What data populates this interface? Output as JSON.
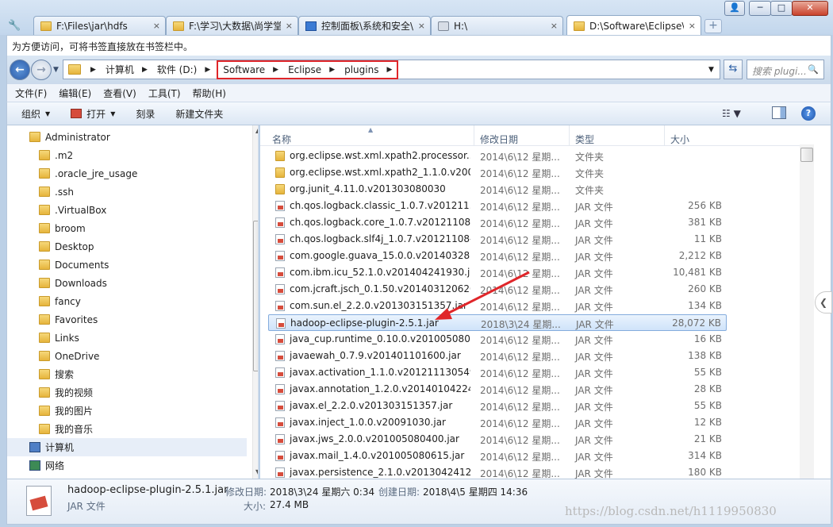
{
  "tabs": [
    {
      "title": "F:\\Files\\jar\\hdfs",
      "icon": "folder-icon",
      "active": false
    },
    {
      "title": "F:\\学习\\大数据\\尚学堂",
      "icon": "folder-icon",
      "active": false
    },
    {
      "title": "控制面板\\系统和安全\\",
      "icon": "control-panel-icon",
      "active": false
    },
    {
      "title": "H:\\",
      "icon": "drive-icon",
      "active": false
    },
    {
      "title": "D:\\Software\\Eclipse\\",
      "icon": "folder-icon",
      "active": true
    }
  ],
  "tab_close": "×",
  "new_tab": "+",
  "window_buttons": {
    "user": "👤",
    "minimize": "─",
    "maximize": "□",
    "close": "✕"
  },
  "bookmark_hint": "为方便访问，可将书签直接放在书签栏中。",
  "address": {
    "crumbs_plain": [
      "计算机",
      "软件 (D:)"
    ],
    "crumbs_highlighted": [
      "Software",
      "Eclipse",
      "plugins"
    ],
    "search_placeholder": "搜索 plugi...",
    "search_icon": "🔍",
    "refresh_icon": "⇆"
  },
  "menu": [
    "文件(F)",
    "编辑(E)",
    "查看(V)",
    "工具(T)",
    "帮助(H)"
  ],
  "toolbar": {
    "organize": "组织",
    "open": "打开",
    "burn": "刻录",
    "new_folder": "新建文件夹",
    "help": "?"
  },
  "nav": {
    "items": [
      {
        "label": "Administrator",
        "icon": "user-folder-icon"
      },
      {
        "label": ".m2",
        "icon": "folder-icon"
      },
      {
        "label": ".oracle_jre_usage",
        "icon": "folder-icon"
      },
      {
        "label": ".ssh",
        "icon": "folder-icon"
      },
      {
        "label": ".VirtualBox",
        "icon": "folder-icon"
      },
      {
        "label": "broom",
        "icon": "folder-icon"
      },
      {
        "label": "Desktop",
        "icon": "desktop-folder-icon"
      },
      {
        "label": "Documents",
        "icon": "documents-folder-icon"
      },
      {
        "label": "Downloads",
        "icon": "downloads-folder-icon"
      },
      {
        "label": "fancy",
        "icon": "folder-icon"
      },
      {
        "label": "Favorites",
        "icon": "favorites-folder-icon"
      },
      {
        "label": "Links",
        "icon": "links-folder-icon"
      },
      {
        "label": "OneDrive",
        "icon": "onedrive-folder-icon"
      },
      {
        "label": "搜索",
        "icon": "search-folder-icon"
      },
      {
        "label": "我的视频",
        "icon": "videos-folder-icon"
      },
      {
        "label": "我的图片",
        "icon": "pictures-folder-icon"
      },
      {
        "label": "我的音乐",
        "icon": "music-folder-icon"
      },
      {
        "label": "计算机",
        "icon": "computer-icon"
      },
      {
        "label": "网络",
        "icon": "network-icon"
      }
    ]
  },
  "columns": {
    "name": "名称",
    "date": "修改日期",
    "type": "类型",
    "size": "大小"
  },
  "files": [
    {
      "name": "org.eclipse.wst.xml.xpath2.processor....",
      "date": "2014\\6\\12 星期...",
      "type": "文件夹",
      "size": "",
      "kind": "folder"
    },
    {
      "name": "org.eclipse.wst.xml.xpath2_1.1.0.v200...",
      "date": "2014\\6\\12 星期...",
      "type": "文件夹",
      "size": "",
      "kind": "folder"
    },
    {
      "name": "org.junit_4.11.0.v201303080030",
      "date": "2014\\6\\12 星期...",
      "type": "文件夹",
      "size": "",
      "kind": "folder"
    },
    {
      "name": "ch.qos.logback.classic_1.0.7.v201211...",
      "date": "2014\\6\\12 星期...",
      "type": "JAR 文件",
      "size": "256 KB",
      "kind": "jar"
    },
    {
      "name": "ch.qos.logback.core_1.0.7.v20121108...",
      "date": "2014\\6\\12 星期...",
      "type": "JAR 文件",
      "size": "381 KB",
      "kind": "jar"
    },
    {
      "name": "ch.qos.logback.slf4j_1.0.7.v20121108-...",
      "date": "2014\\6\\12 星期...",
      "type": "JAR 文件",
      "size": "11 KB",
      "kind": "jar"
    },
    {
      "name": "com.google.guava_15.0.0.v20140328...",
      "date": "2014\\6\\12 星期...",
      "type": "JAR 文件",
      "size": "2,212 KB",
      "kind": "jar"
    },
    {
      "name": "com.ibm.icu_52.1.0.v201404241930.jar",
      "date": "2014\\6\\12 星期...",
      "type": "JAR 文件",
      "size": "10,481 KB",
      "kind": "jar"
    },
    {
      "name": "com.jcraft.jsch_0.1.50.v201403120620....",
      "date": "2014\\6\\12 星期...",
      "type": "JAR 文件",
      "size": "260 KB",
      "kind": "jar"
    },
    {
      "name": "com.sun.el_2.2.0.v201303151357.jar",
      "date": "2014\\6\\12 星期...",
      "type": "JAR 文件",
      "size": "134 KB",
      "kind": "jar"
    },
    {
      "name": "hadoop-eclipse-plugin-2.5.1.jar",
      "date": "2018\\3\\24 星期...",
      "type": "JAR 文件",
      "size": "28,072 KB",
      "kind": "jar",
      "selected": true
    },
    {
      "name": "java_cup.runtime_0.10.0.v2010050804...",
      "date": "2014\\6\\12 星期...",
      "type": "JAR 文件",
      "size": "16 KB",
      "kind": "jar"
    },
    {
      "name": "javaewah_0.7.9.v201401101600.jar",
      "date": "2014\\6\\12 星期...",
      "type": "JAR 文件",
      "size": "138 KB",
      "kind": "jar"
    },
    {
      "name": "javax.activation_1.1.0.v201211130549....",
      "date": "2014\\6\\12 星期...",
      "type": "JAR 文件",
      "size": "55 KB",
      "kind": "jar"
    },
    {
      "name": "javax.annotation_1.2.0.v20140104224...",
      "date": "2014\\6\\12 星期...",
      "type": "JAR 文件",
      "size": "28 KB",
      "kind": "jar"
    },
    {
      "name": "javax.el_2.2.0.v201303151357.jar",
      "date": "2014\\6\\12 星期...",
      "type": "JAR 文件",
      "size": "55 KB",
      "kind": "jar"
    },
    {
      "name": "javax.inject_1.0.0.v20091030.jar",
      "date": "2014\\6\\12 星期...",
      "type": "JAR 文件",
      "size": "12 KB",
      "kind": "jar"
    },
    {
      "name": "javax.jws_2.0.0.v201005080400.jar",
      "date": "2014\\6\\12 星期...",
      "type": "JAR 文件",
      "size": "21 KB",
      "kind": "jar"
    },
    {
      "name": "javax.mail_1.4.0.v201005080615.jar",
      "date": "2014\\6\\12 星期...",
      "type": "JAR 文件",
      "size": "314 KB",
      "kind": "jar"
    },
    {
      "name": "javax.persistence_2.1.0.v20130424121...",
      "date": "2014\\6\\12 星期...",
      "type": "JAR 文件",
      "size": "180 KB",
      "kind": "jar"
    }
  ],
  "details": {
    "filename": "hadoop-eclipse-plugin-2.5.1.jar",
    "filetype": "JAR 文件",
    "modified_label": "修改日期:",
    "modified_value": "2018\\3\\24 星期六 0:34",
    "created_label": "创建日期:",
    "created_value": "2018\\4\\5 星期四 14:36",
    "size_label": "大小:",
    "size_value": "27.4 MB"
  },
  "watermark": "https://blog.csdn.net/h1119950830",
  "colors": {
    "highlight_box": "#e0262a",
    "annotation_arrow": "#e0262a",
    "selection": "#cfe3fa"
  }
}
